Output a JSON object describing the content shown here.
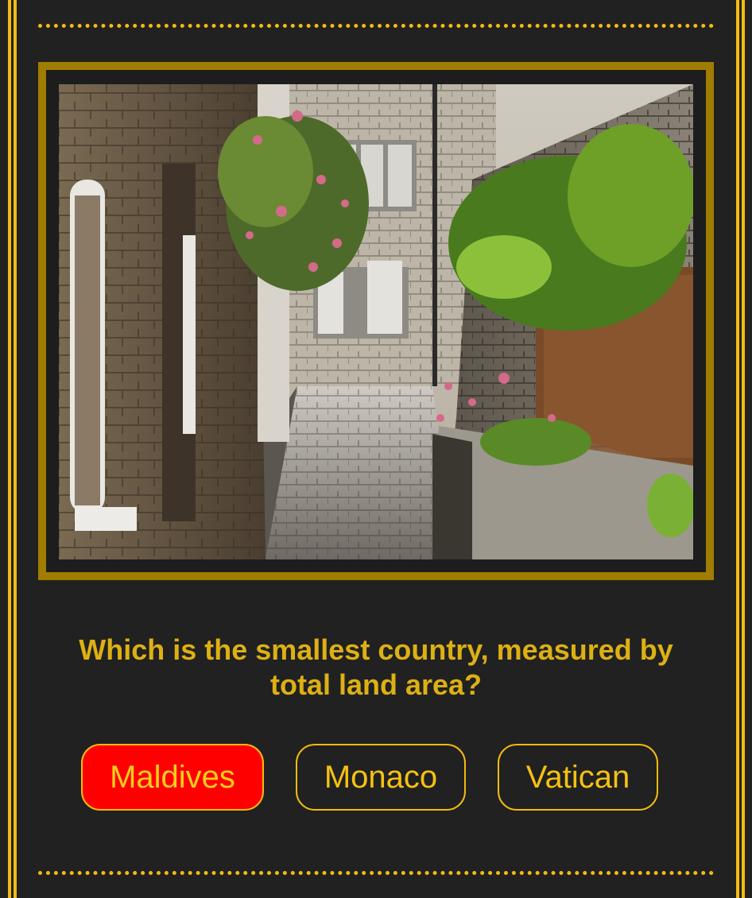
{
  "quiz": {
    "question": "Which is the smallest country, measured by total land area?",
    "answers": [
      "Maldives",
      "Monaco",
      "Vatican"
    ],
    "selected_answer": "Maldives",
    "photo_description_icon": "alley-photo"
  },
  "colors": {
    "background": "#212121",
    "accent": "#f2bb10",
    "frame": "#a07c00",
    "question_text": "#ddb014",
    "selected_answer_bg": "#ff0000"
  }
}
